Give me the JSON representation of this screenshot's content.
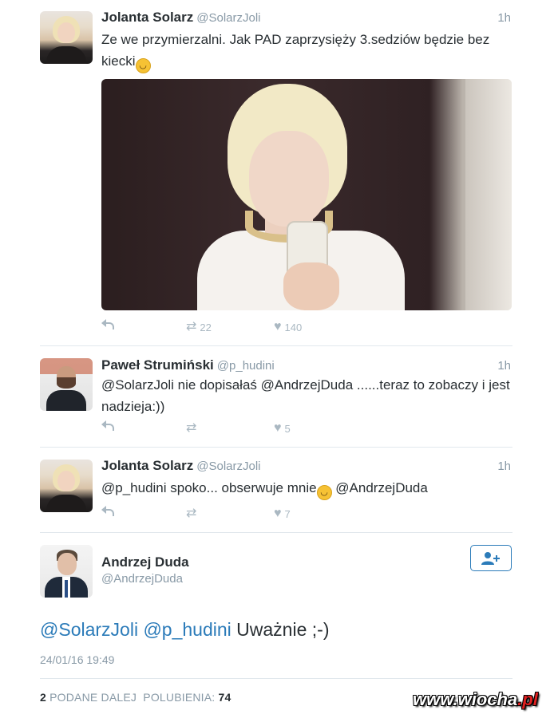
{
  "tweets": [
    {
      "name": "Jolanta Solarz",
      "handle": "@SolarzJoli",
      "time": "1h",
      "text": "Ze we przymierzalni. Jak PAD zaprzysięży 3.sedziów będzie bez kiecki",
      "emoji": "smiling-face-emoji",
      "retweets": "22",
      "likes": "140"
    },
    {
      "name": "Paweł Strumiński",
      "handle": "@p_hudini",
      "time": "1h",
      "text": "@SolarzJoli nie dopisałaś @AndrzejDuda ......teraz to zobaczy i jest nadzieja:))",
      "retweets": "",
      "likes": "5"
    },
    {
      "name": "Jolanta Solarz",
      "handle": "@SolarzJoli",
      "time": "1h",
      "text": "@p_hudini spoko... obserwuje mnie",
      "text_after_emoji": " @AndrzejDuda",
      "emoji": "winking-face-emoji",
      "retweets": "",
      "likes": "7"
    }
  ],
  "main_tweet": {
    "name": "Andrzej Duda",
    "handle": "@AndrzejDuda",
    "mention1": "@SolarzJoli",
    "mention2": "@p_hudini",
    "text": "Uważnie ;-)",
    "date": "24/01/16 19:49",
    "retweet_count": "2",
    "retweet_label": "PODANE DALEJ",
    "likes_label": "POLUBIENIA:",
    "likes_count": "74"
  },
  "watermark": {
    "main": "www.wiocha",
    "suffix": ".pl"
  }
}
